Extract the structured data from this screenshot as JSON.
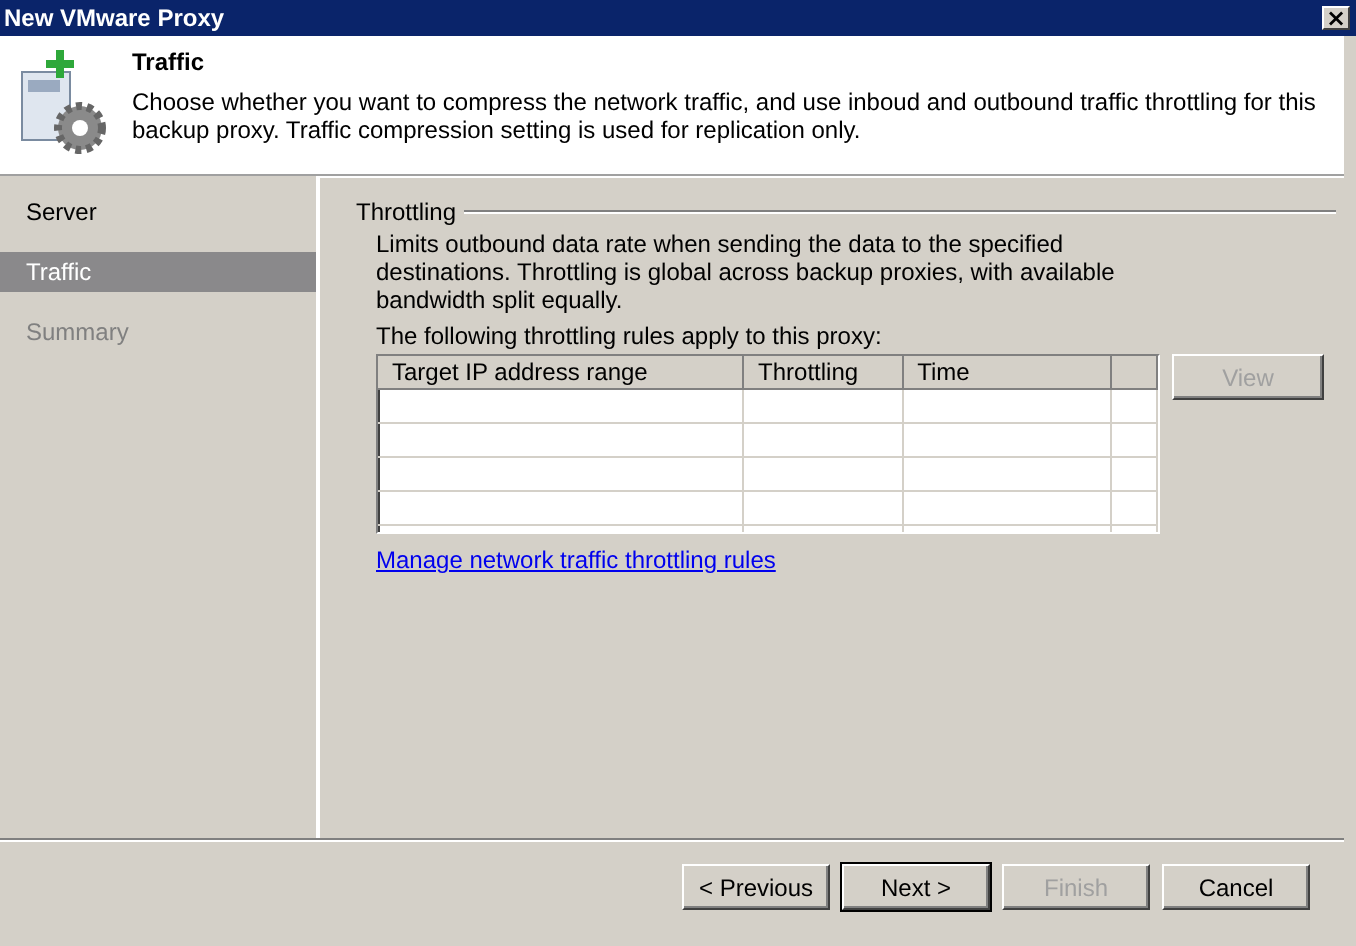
{
  "window": {
    "title": "New VMware Proxy",
    "close": "×"
  },
  "header": {
    "title": "Traffic",
    "description": "Choose whether you want to compress the network traffic, and use inboud and outbound traffic throttling for this backup proxy. Traffic compression setting is used for replication only."
  },
  "sidebar": {
    "items": [
      {
        "label": "Server",
        "selected": false,
        "disabled": false
      },
      {
        "label": "Traffic",
        "selected": true,
        "disabled": false
      },
      {
        "label": "Summary",
        "selected": false,
        "disabled": true
      }
    ]
  },
  "throttling": {
    "legend": "Throttling",
    "description": "Limits outbound data rate when sending the data to the specified destinations. Throttling is global across backup proxies, with available bandwidth split equally.",
    "rules_label": "The following throttling rules apply to this proxy:",
    "table": {
      "columns": [
        "Target IP address range",
        "Throttling",
        "Time"
      ]
    },
    "view_button": {
      "label": "View",
      "disabled": true
    },
    "link": "Manage network traffic throttling rules"
  },
  "buttons": [
    {
      "label": "< Previous",
      "disabled": false,
      "default": false
    },
    {
      "label": "Next >",
      "disabled": false,
      "default": true
    },
    {
      "label": "Finish",
      "disabled": true,
      "default": false
    },
    {
      "label": "Cancel",
      "disabled": false,
      "default": false
    }
  ]
}
